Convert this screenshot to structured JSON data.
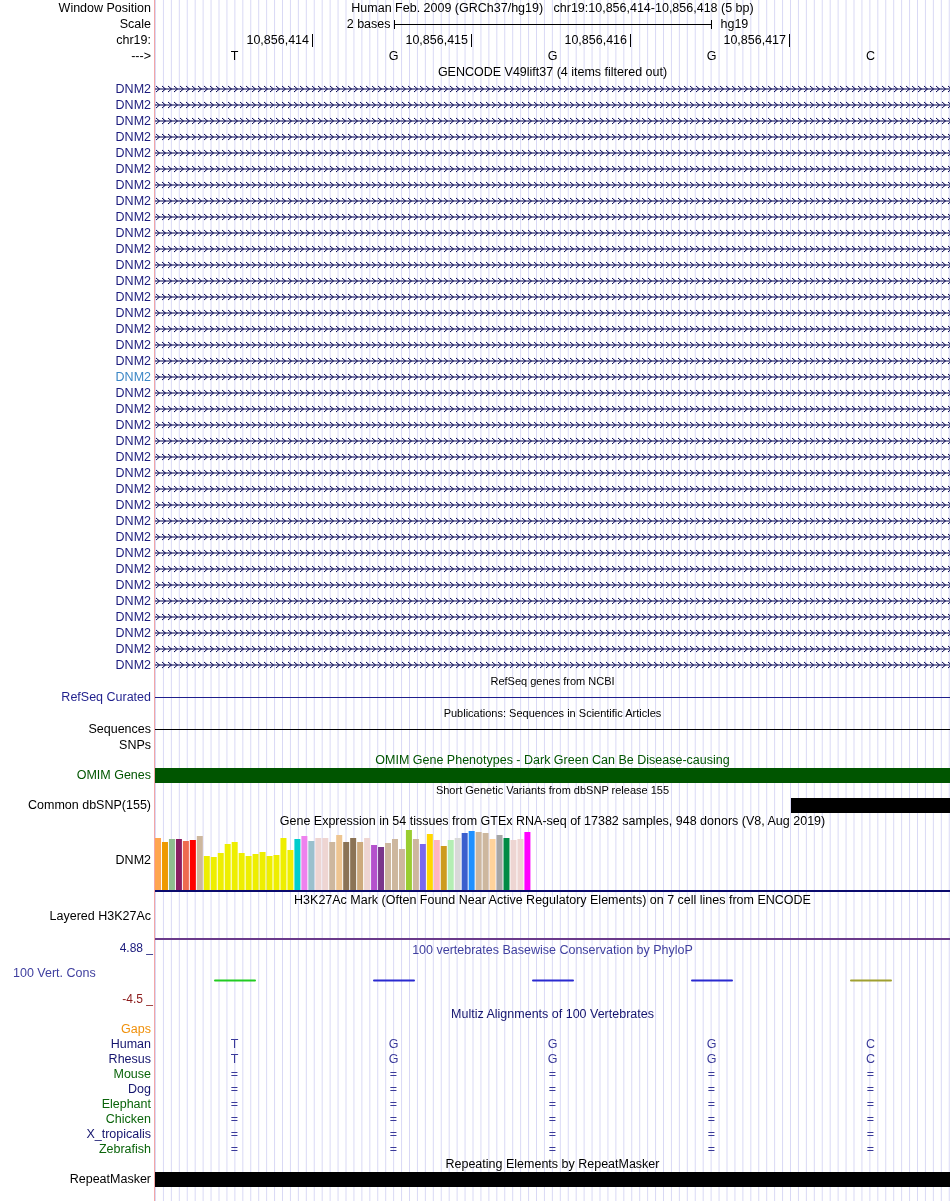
{
  "header": {
    "window_position_label": "Window Position",
    "window_position": "Human Feb. 2009 (GRCh37/hg19)   chr19:10,856,414-10,856,418 (5 bp)",
    "scale_label": "Scale",
    "scale_span": "2 bases",
    "scale_assembly": "hg19",
    "chrom_label": "chr19:",
    "positions": [
      "10,856,414",
      "10,856,415",
      "10,856,416",
      "10,856,417"
    ],
    "strand_label": "--->",
    "bases": [
      "T",
      "G",
      "G",
      "G",
      "C"
    ]
  },
  "tracks": [
    {
      "kind": "genes",
      "title": "GENCODE V49lift37 (4 items filtered out)",
      "items": [
        {
          "name": "DNM2",
          "highlighted": false
        },
        {
          "name": "DNM2",
          "highlighted": false
        },
        {
          "name": "DNM2",
          "highlighted": false
        },
        {
          "name": "DNM2",
          "highlighted": false
        },
        {
          "name": "DNM2",
          "highlighted": false
        },
        {
          "name": "DNM2",
          "highlighted": false
        },
        {
          "name": "DNM2",
          "highlighted": false
        },
        {
          "name": "DNM2",
          "highlighted": false
        },
        {
          "name": "DNM2",
          "highlighted": false
        },
        {
          "name": "DNM2",
          "highlighted": false
        },
        {
          "name": "DNM2",
          "highlighted": false
        },
        {
          "name": "DNM2",
          "highlighted": false
        },
        {
          "name": "DNM2",
          "highlighted": false
        },
        {
          "name": "DNM2",
          "highlighted": false
        },
        {
          "name": "DNM2",
          "highlighted": false
        },
        {
          "name": "DNM2",
          "highlighted": false
        },
        {
          "name": "DNM2",
          "highlighted": false
        },
        {
          "name": "DNM2",
          "highlighted": false
        },
        {
          "name": "DNM2",
          "highlighted": true
        },
        {
          "name": "DNM2",
          "highlighted": false
        },
        {
          "name": "DNM2",
          "highlighted": false
        },
        {
          "name": "DNM2",
          "highlighted": false
        },
        {
          "name": "DNM2",
          "highlighted": false
        },
        {
          "name": "DNM2",
          "highlighted": false
        },
        {
          "name": "DNM2",
          "highlighted": false
        },
        {
          "name": "DNM2",
          "highlighted": false
        },
        {
          "name": "DNM2",
          "highlighted": false
        },
        {
          "name": "DNM2",
          "highlighted": false
        },
        {
          "name": "DNM2",
          "highlighted": false
        },
        {
          "name": "DNM2",
          "highlighted": false
        },
        {
          "name": "DNM2",
          "highlighted": false
        },
        {
          "name": "DNM2",
          "highlighted": false
        },
        {
          "name": "DNM2",
          "highlighted": false
        },
        {
          "name": "DNM2",
          "highlighted": false
        },
        {
          "name": "DNM2",
          "highlighted": false
        },
        {
          "name": "DNM2",
          "highlighted": false
        },
        {
          "name": "DNM2",
          "highlighted": false
        }
      ]
    },
    {
      "kind": "line",
      "title": "RefSeq genes from NCBI",
      "label": "RefSeq Curated",
      "color": "#1f1f8c"
    },
    {
      "kind": "line",
      "title": "Publications: Sequences in Scientific Articles",
      "label": "Sequences",
      "color": "#000000"
    },
    {
      "kind": "empty",
      "label": "SNPs",
      "color": "#000000"
    },
    {
      "kind": "bar",
      "title": "OMIM Gene Phenotypes - Dark Green Can Be Disease-causing",
      "label": "OMIM Genes",
      "color": "#005500",
      "level": 1
    },
    {
      "kind": "bar",
      "title": "Short Genetic Variants from dbSNP release 155",
      "label": "Common dbSNP(155)",
      "color": "#000000",
      "level": 0.2
    },
    {
      "kind": "expression",
      "title": "Gene Expression in 54 tissues from GTEx RNA-seq of 17382 samples, 948 donors (V8, Aug 2019)",
      "label": "DNM2",
      "color": "#000000"
    },
    {
      "kind": "layered",
      "title": "H3K27Ac Mark (Often Found Near Active Regulatory Elements) on 7 cell lines from ENCODE",
      "label": "Layered H3K27Ac",
      "color": "#000000"
    },
    {
      "kind": "conservation",
      "title": "100 vertebrates Basewise Conservation by PhyloP",
      "label": "100 Vert. Cons",
      "color": "#3f3f9f",
      "max_label": "4.88 _",
      "min_label": "-4.5 _"
    },
    {
      "kind": "alignment",
      "title": "Multiz Alignments of 100 Vertebrates",
      "color": "#14146e",
      "species": [
        {
          "name": "Gaps",
          "color": "#f0900a"
        },
        {
          "name": "Human",
          "color": "#14146e",
          "bases": [
            "T",
            "G",
            "G",
            "G",
            "C"
          ]
        },
        {
          "name": "Rhesus",
          "color": "#14146e",
          "bases": [
            "T",
            "G",
            "G",
            "G",
            "C"
          ]
        },
        {
          "name": "Mouse",
          "color": "#0a640a",
          "bases": [
            "=",
            "=",
            "=",
            "=",
            "="
          ]
        },
        {
          "name": "Dog",
          "color": "#14146e",
          "bases": [
            "=",
            "=",
            "=",
            "=",
            "="
          ]
        },
        {
          "name": "Elephant",
          "color": "#0a640a",
          "bases": [
            "=",
            "=",
            "=",
            "=",
            "="
          ]
        },
        {
          "name": "Chicken",
          "color": "#0a640a",
          "bases": [
            "=",
            "=",
            "=",
            "=",
            "="
          ]
        },
        {
          "name": "X_tropicalis",
          "color": "#14146e",
          "bases": [
            "=",
            "=",
            "=",
            "=",
            "="
          ]
        },
        {
          "name": "Zebrafish",
          "color": "#0a640a",
          "bases": [
            "=",
            "=",
            "=",
            "=",
            "="
          ]
        }
      ]
    },
    {
      "kind": "bar",
      "title": "Repeating Elements by RepeatMasker",
      "label": "RepeatMasker",
      "color": "#000000",
      "level": 1
    }
  ]
}
